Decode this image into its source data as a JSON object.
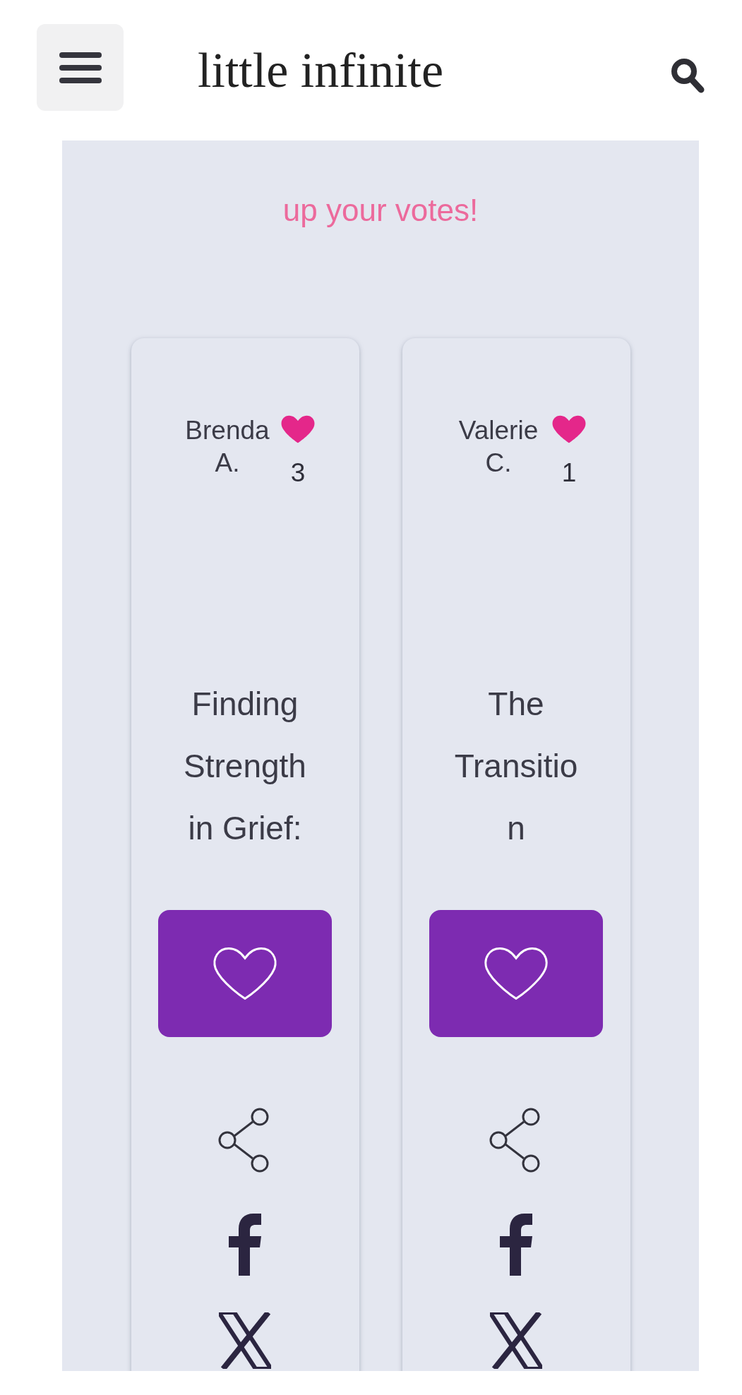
{
  "header": {
    "logo": "little infinite"
  },
  "intro": {
    "lines": [
      "up your votes!"
    ]
  },
  "entries": [
    {
      "name": "Brenda A.",
      "votes": "3",
      "title": "Finding Strength in Grief:"
    },
    {
      "name": "Valerie C.",
      "votes": "1",
      "title": "The Transition"
    }
  ]
}
